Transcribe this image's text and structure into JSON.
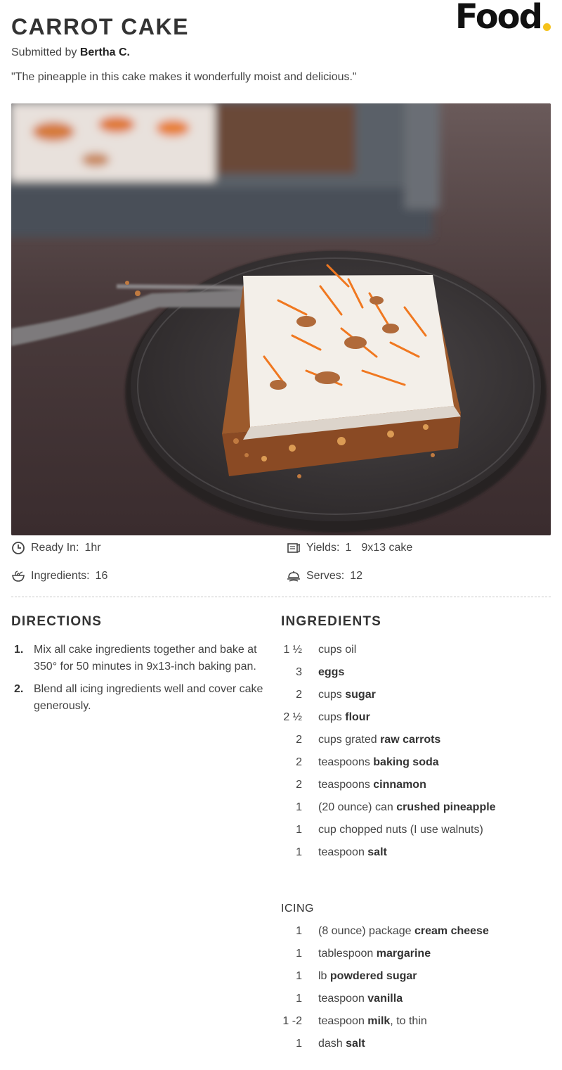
{
  "recipe": {
    "title": "CARROT CAKE",
    "submitted_prefix": "Submitted by",
    "author": "Bertha C.",
    "quote": "\"The pineapple in this cake makes it wonderfully moist and delicious.\""
  },
  "brand": {
    "logo_text": "Food",
    "dot_color": "#f5c21b"
  },
  "photo": {
    "alt_icon": "carrot-cake-photo"
  },
  "meta": {
    "ready_label": "Ready In:",
    "ready_value": "1hr",
    "yields_label": "Yields:",
    "yields_value": "1",
    "yields_unit": "9x13 cake",
    "ingredients_label": "Ingredients:",
    "ingredients_value": "16",
    "serves_label": "Serves:",
    "serves_value": "12"
  },
  "directions": {
    "heading": "DIRECTIONS",
    "steps": [
      {
        "num": "1.",
        "text": "Mix all cake ingredients together and bake at 350° for 50 minutes in 9x13-inch baking pan."
      },
      {
        "num": "2.",
        "text": "Blend all icing ingredients well and cover cake generously."
      }
    ]
  },
  "ingredients": {
    "heading": "INGREDIENTS",
    "cake": [
      {
        "qty": "1 ½",
        "pre": "cups oil",
        "bold": "",
        "post": ""
      },
      {
        "qty": "3",
        "pre": "",
        "bold": "eggs",
        "post": ""
      },
      {
        "qty": "2",
        "pre": "cups ",
        "bold": "sugar",
        "post": ""
      },
      {
        "qty": "2 ½",
        "pre": "cups ",
        "bold": "flour",
        "post": ""
      },
      {
        "qty": "2",
        "pre": "cups grated ",
        "bold": "raw carrots",
        "post": ""
      },
      {
        "qty": "2",
        "pre": "teaspoons ",
        "bold": "baking soda",
        "post": ""
      },
      {
        "qty": "2",
        "pre": "teaspoons ",
        "bold": "cinnamon",
        "post": ""
      },
      {
        "qty": "1",
        "pre": "(20 ounce) can ",
        "bold": "crushed pineapple",
        "post": ""
      },
      {
        "qty": "1",
        "pre": "cup chopped nuts (I use walnuts)",
        "bold": "",
        "post": ""
      },
      {
        "qty": "1",
        "pre": "teaspoon ",
        "bold": "salt",
        "post": ""
      }
    ],
    "icing_heading": "ICING",
    "icing": [
      {
        "qty": "1",
        "pre": "(8 ounce) package ",
        "bold": "cream cheese",
        "post": ""
      },
      {
        "qty": "1",
        "pre": "tablespoon ",
        "bold": "margarine",
        "post": ""
      },
      {
        "qty": "1",
        "pre": "lb ",
        "bold": "powdered sugar",
        "post": ""
      },
      {
        "qty": "1",
        "pre": "teaspoon ",
        "bold": "vanilla",
        "post": ""
      },
      {
        "qty": "1 -2",
        "pre": "teaspoon ",
        "bold": "milk",
        "post": ", to thin"
      },
      {
        "qty": "1",
        "pre": "dash ",
        "bold": "salt",
        "post": ""
      }
    ]
  }
}
